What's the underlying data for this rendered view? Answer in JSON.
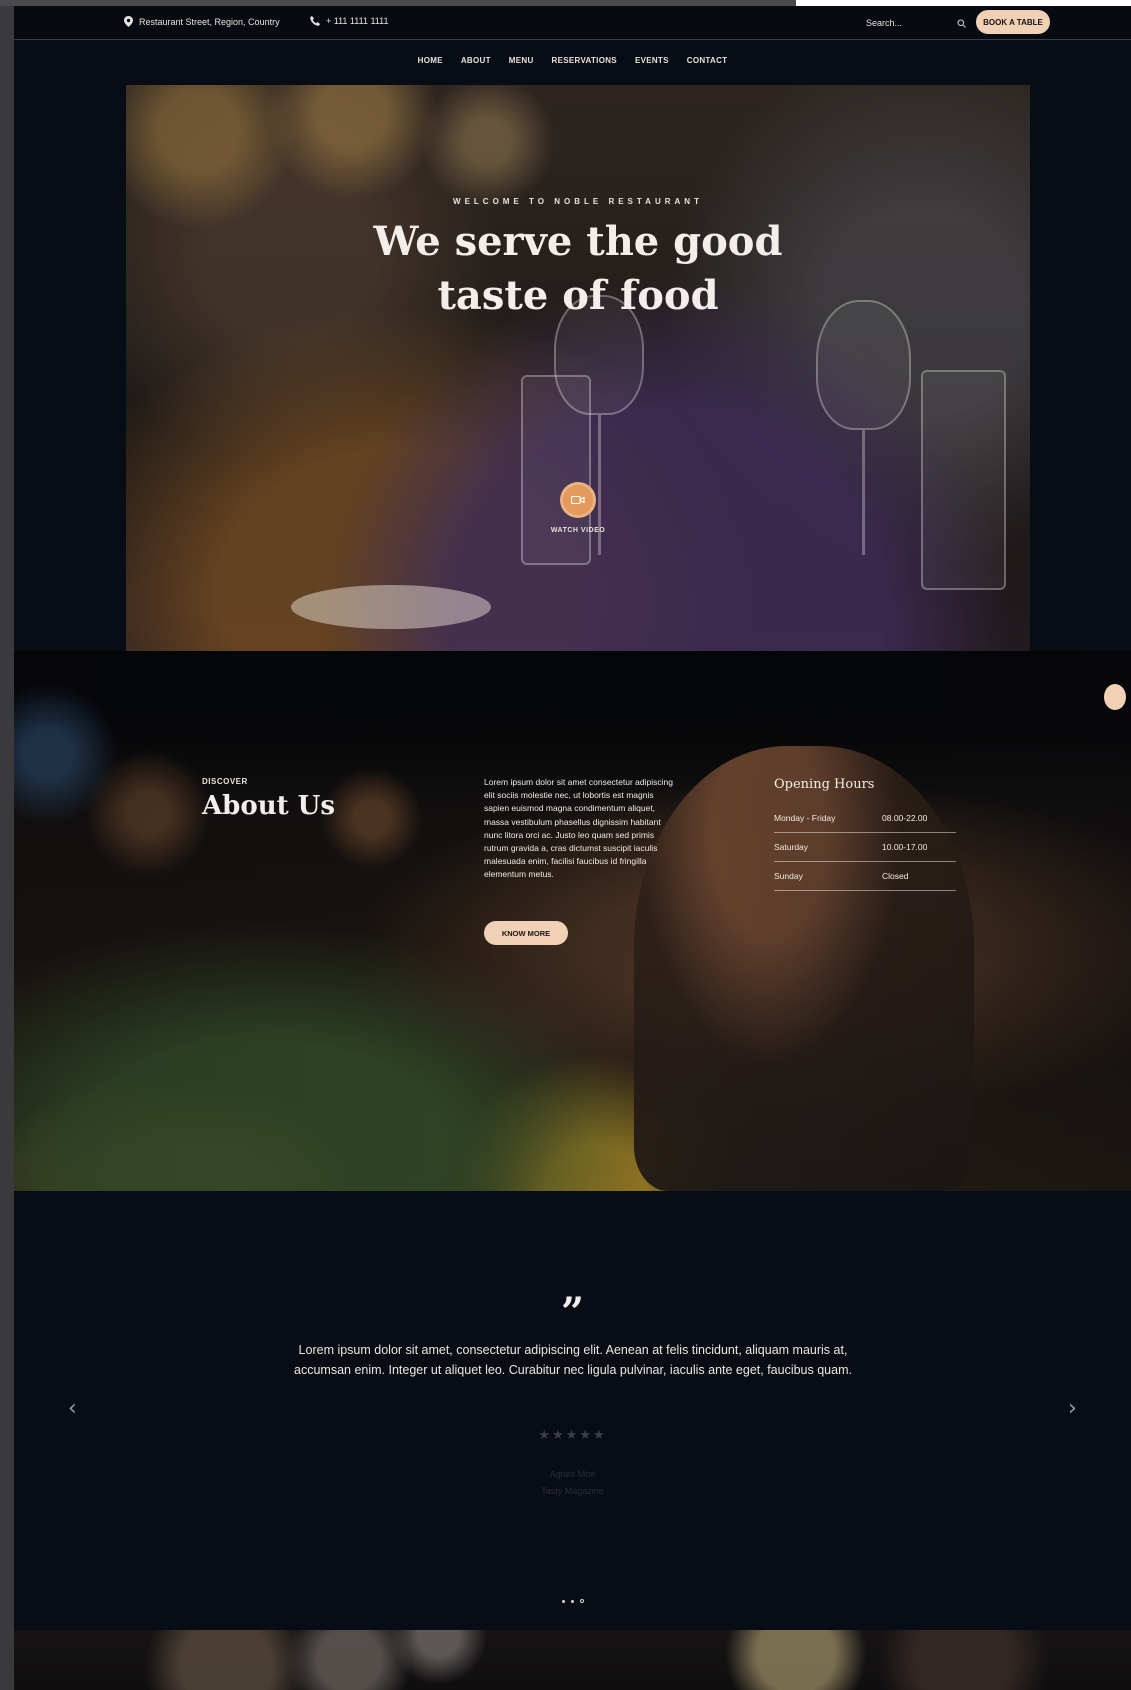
{
  "topbar": {
    "address": "Restaurant Street, Region, Country",
    "phone": "+ 111 1111 1111",
    "search_placeholder": "Search...",
    "book_button": "BOOK A TABLE"
  },
  "nav": {
    "items": [
      "HOME",
      "ABOUT",
      "MENU",
      "RESERVATIONS",
      "EVENTS",
      "CONTACT"
    ]
  },
  "hero": {
    "eyebrow": "WELCOME TO NOBLE RESTAURANT",
    "title_line1": "We serve the good",
    "title_line2": "taste of food",
    "video_label": "WATCH VIDEO"
  },
  "about": {
    "eyebrow": "DISCOVER",
    "title": "About Us",
    "text": "Lorem ipsum dolor sit amet consectetur adipiscing elit sociis molestie nec, ut lobortis est magnis sapien euismod magna condimentum aliquet, massa vestibulum phasellus dignissim habitant nunc litora orci ac. Justo leo quam sed primis rutrum gravida a, cras dictumst suscipit iaculis malesuada enim, facilisi faucibus id fringilla elementum metus.",
    "button": "KNOW MORE",
    "hours_title": "Opening Hours",
    "hours": [
      {
        "day": "Monday - Friday",
        "time": "08.00-22.00"
      },
      {
        "day": "Saturday",
        "time": "10.00-17.00"
      },
      {
        "day": "Sunday",
        "time": "Closed"
      }
    ]
  },
  "testimonial": {
    "quote_mark": "”",
    "text": "Lorem ipsum dolor sit amet, consectetur adipiscing elit. Aenean at felis tincidunt, aliquam mauris at, accumsan enim. Integer ut aliquet leo. Curabitur nec ligula pulvinar, iaculis ante eget, faucibus quam.",
    "stars": "★★★★★",
    "author_name": "Agnes Moe",
    "author_source": "Tasty Magazine",
    "prev": "‹",
    "next": "›"
  },
  "colors": {
    "accent": "#f1d1b5",
    "play": "#e39a5b",
    "background": "#080c14"
  }
}
